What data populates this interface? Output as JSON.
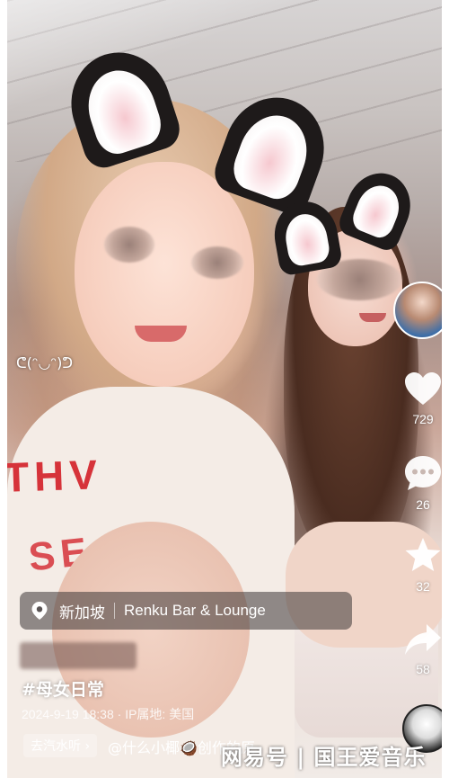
{
  "overlay": {
    "emote": "ᕦ(ᵔ◡ᵔ)ᕤ"
  },
  "tshirt": {
    "line1": "THV",
    "line2": "SE"
  },
  "sidebar": {
    "like_count": "729",
    "comment_count": "26",
    "favorite_count": "32",
    "share_count": "58"
  },
  "location": {
    "city": "新加坡",
    "place": "Renku Bar & Lounge"
  },
  "post": {
    "hashtag": "#母女日常",
    "meta": "2024-9-19 18:38 · IP属地: 美国"
  },
  "music": {
    "pill_label": "去汽水听 ›",
    "track_text": "@什么小椰🥥创作的原"
  },
  "watermark": {
    "text": "网易号 | 国王爱音乐"
  },
  "colors": {
    "tshirt_print": "#d6333a",
    "overlay_pill": "rgba(60,55,55,0.55)"
  }
}
